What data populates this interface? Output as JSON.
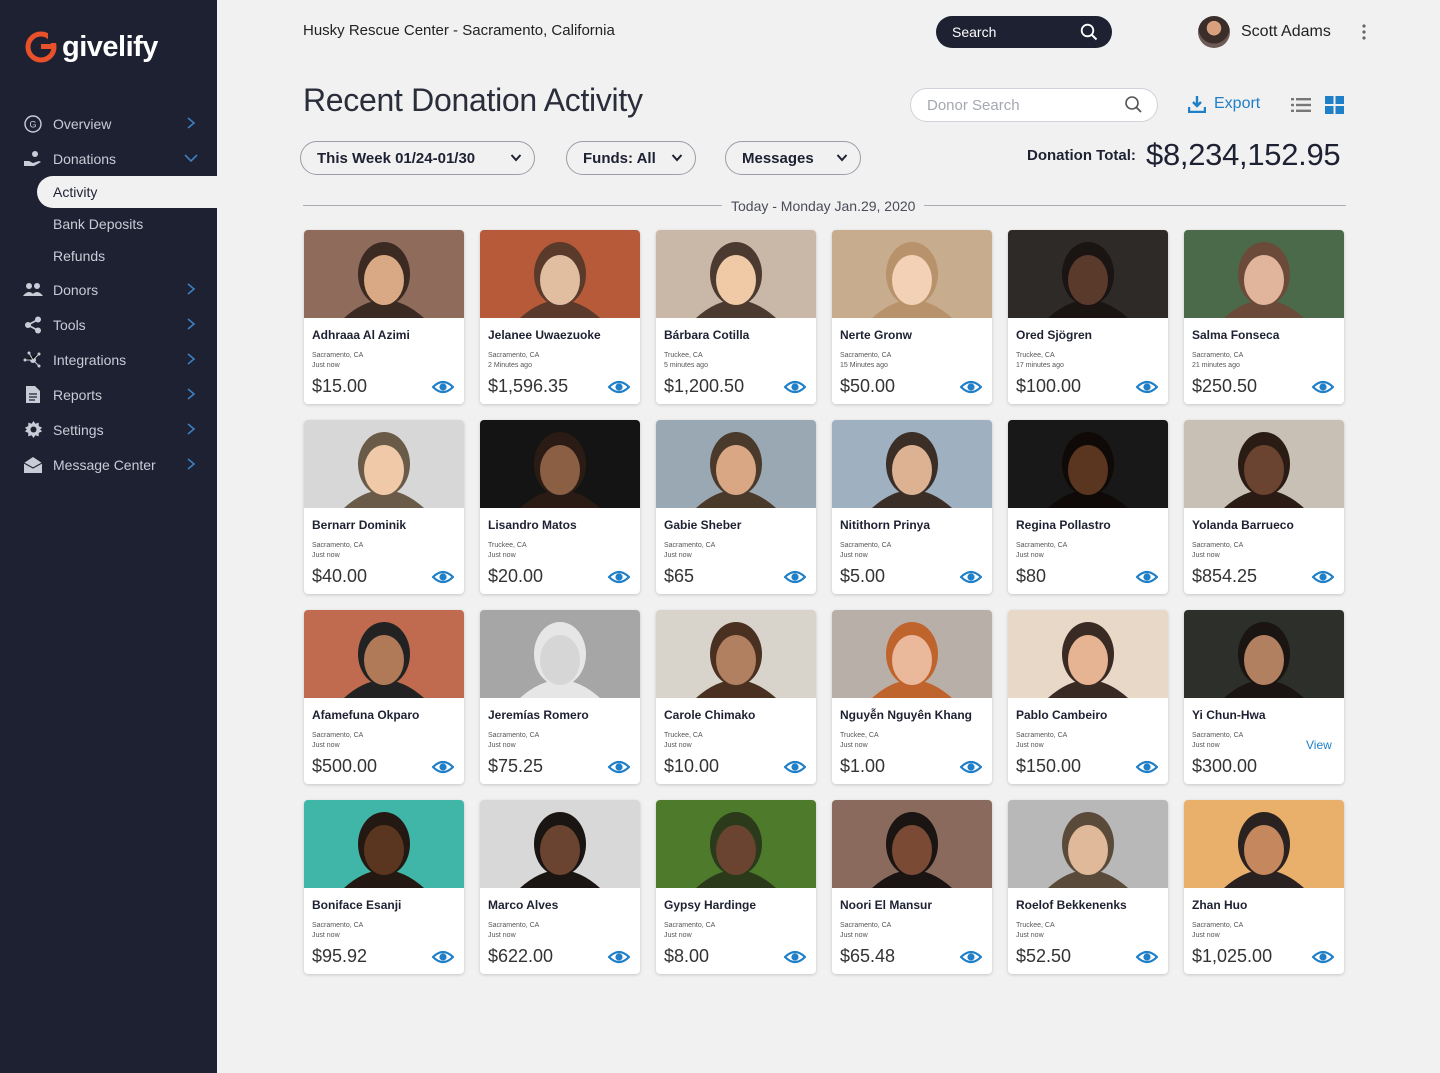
{
  "app": {
    "brand": "givelify"
  },
  "header": {
    "org_title": "Husky Rescue Center - Sacramento, California",
    "search_label": "Search",
    "user_name": "Scott Adams"
  },
  "sidebar": {
    "items": [
      {
        "label": "Overview",
        "icon": "overview-icon"
      },
      {
        "label": "Donations",
        "icon": "donations-icon",
        "expanded": true
      },
      {
        "label": "Donors",
        "icon": "donors-icon"
      },
      {
        "label": "Tools",
        "icon": "share-icon"
      },
      {
        "label": "Integrations",
        "icon": "integrations-icon"
      },
      {
        "label": "Reports",
        "icon": "document-icon"
      },
      {
        "label": "Settings",
        "icon": "gear-icon"
      },
      {
        "label": "Message Center",
        "icon": "envelope-icon"
      }
    ],
    "sub_items": [
      "Activity",
      "Bank Deposits",
      "Refunds"
    ],
    "active_sub": "Activity"
  },
  "main": {
    "title": "Recent Donation Activity",
    "donor_search_placeholder": "Donor Search",
    "export_label": "Export",
    "filters": {
      "week": "This Week 01/24-01/30",
      "funds": "Funds: All",
      "messages": "Messages"
    },
    "total_label": "Donation Total:",
    "total_value": "$8,234,152.95",
    "date_divider": "Today - Monday Jan.29, 2020"
  },
  "colors": {
    "sidebar": "#1e2132",
    "accent": "#1f7fc7",
    "brand_orange": "#e8512a"
  },
  "donations": [
    {
      "name": "Adhraaa Al Azimi",
      "location": "Sacramento, CA",
      "time": "Just now",
      "amount": "$15.00",
      "action": "eye"
    },
    {
      "name": "Jelanee Uwaezuoke",
      "location": "Sacramento, CA",
      "time": "2 Minutes ago",
      "amount": "$1,596.35",
      "action": "eye"
    },
    {
      "name": "Bárbara Cotilla",
      "location": "Truckee, CA",
      "time": "5 minutes ago",
      "amount": "$1,200.50",
      "action": "eye"
    },
    {
      "name": "Nerte Gronw",
      "location": "Sacramento, CA",
      "time": "15 Minutes ago",
      "amount": "$50.00",
      "action": "eye"
    },
    {
      "name": "Ored Sjögren",
      "location": "Truckee, CA",
      "time": "17 minutes ago",
      "amount": "$100.00",
      "action": "eye"
    },
    {
      "name": "Salma Fonseca",
      "location": "Sacramento, CA",
      "time": "21 minutes ago",
      "amount": "$250.50",
      "action": "eye"
    },
    {
      "name": "Bernarr Dominik",
      "location": "Sacramento, CA",
      "time": "Just now",
      "amount": "$40.00",
      "action": "eye"
    },
    {
      "name": "Lisandro Matos",
      "location": "Truckee, CA",
      "time": "Just now",
      "amount": "$20.00",
      "action": "eye"
    },
    {
      "name": "Gabie Sheber",
      "location": "Sacramento, CA",
      "time": "Just now",
      "amount": "$65",
      "action": "eye"
    },
    {
      "name": "Nitithorn Prinya",
      "location": "Sacramento, CA",
      "time": "Just now",
      "amount": "$5.00",
      "action": "eye"
    },
    {
      "name": "Regina Pollastro",
      "location": "Sacramento, CA",
      "time": "Just now",
      "amount": "$80",
      "action": "eye"
    },
    {
      "name": "Yolanda Barrueco",
      "location": "Sacramento, CA",
      "time": "Just now",
      "amount": "$854.25",
      "action": "eye"
    },
    {
      "name": "Afamefuna Okparo",
      "location": "Sacramento, CA",
      "time": "Just now",
      "amount": "$500.00",
      "action": "eye"
    },
    {
      "name": "Jeremías Romero",
      "location": "Sacramento, CA",
      "time": "Just now",
      "amount": "$75.25",
      "action": "eye"
    },
    {
      "name": "Carole Chimako",
      "location": "Truckee, CA",
      "time": "Just now",
      "amount": "$10.00",
      "action": "eye"
    },
    {
      "name": "Nguyễn Nguyên Khang",
      "location": "Truckee, CA",
      "time": "Just now",
      "amount": "$1.00",
      "action": "eye"
    },
    {
      "name": "Pablo Cambeiro",
      "location": "Sacramento, CA",
      "time": "Just now",
      "amount": "$150.00",
      "action": "eye"
    },
    {
      "name": "Yi Chun-Hwa",
      "location": "Sacramento, CA",
      "time": "Just now",
      "amount": "$300.00",
      "action": "view",
      "action_label": "View"
    },
    {
      "name": "Boniface Esanji",
      "location": "Sacramento, CA",
      "time": "Just now",
      "amount": "$95.92",
      "action": "eye"
    },
    {
      "name": "Marco Alves",
      "location": "Sacramento, CA",
      "time": "Just now",
      "amount": "$622.00",
      "action": "eye"
    },
    {
      "name": "Gypsy Hardinge",
      "location": "Sacramento, CA",
      "time": "Just now",
      "amount": "$8.00",
      "action": "eye"
    },
    {
      "name": "Noori El Mansur",
      "location": "Sacramento, CA",
      "time": "Just now",
      "amount": "$65.48",
      "action": "eye"
    },
    {
      "name": "Roelof Bekkenenks",
      "location": "Truckee, CA",
      "time": "Just now",
      "amount": "$52.50",
      "action": "eye"
    },
    {
      "name": "Zhan Huo",
      "location": "Sacramento, CA",
      "time": "Just now",
      "amount": "$1,025.00",
      "action": "eye"
    }
  ]
}
